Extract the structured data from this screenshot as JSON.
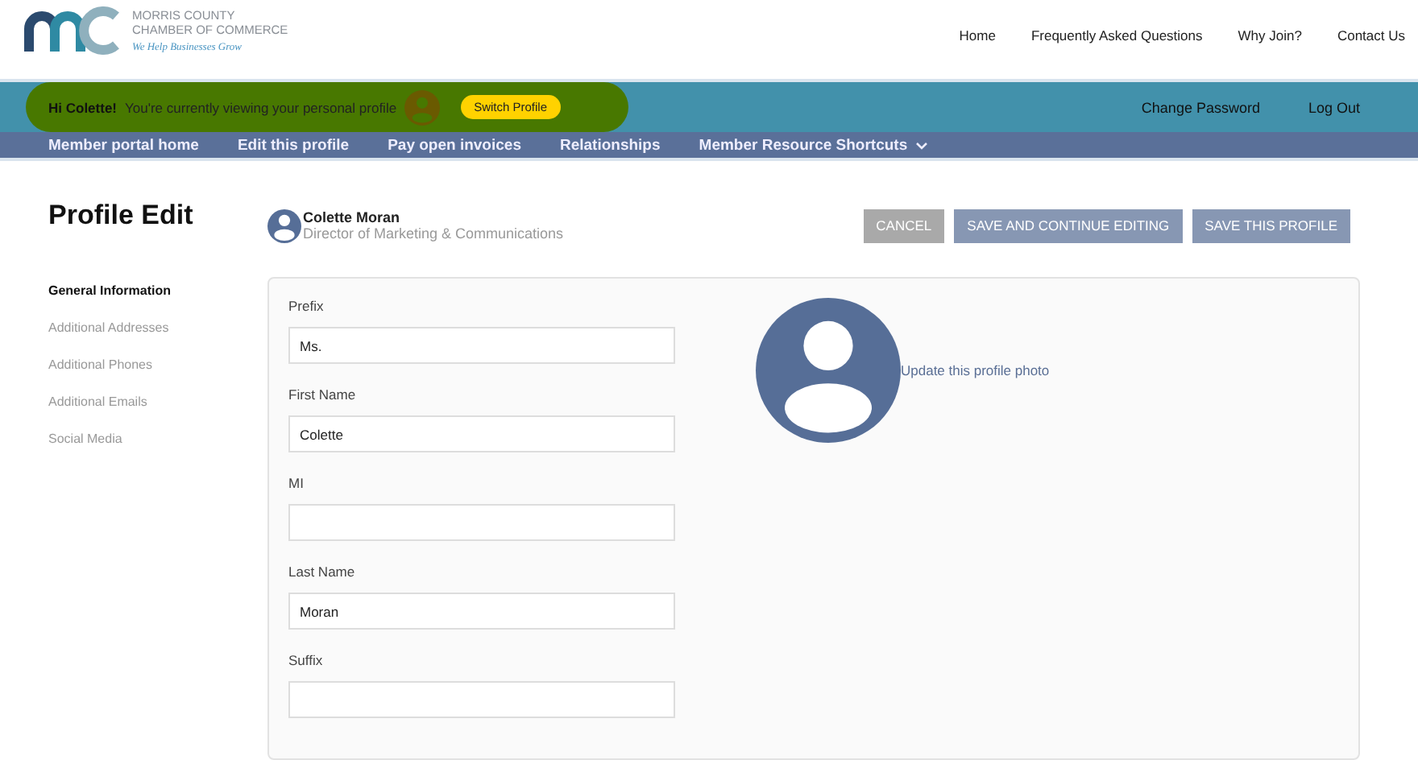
{
  "logo": {
    "line_1": "MORRIS COUNTY",
    "line_2": "CHAMBER OF COMMERCE",
    "tagline": "We Help Businesses Grow"
  },
  "top_nav": [
    "Home",
    "Frequently Asked Questions",
    "Why Join?",
    "Contact Us"
  ],
  "greeting": {
    "name": "Hi Colette!",
    "message": "You're currently viewing your personal profile",
    "button": "Switch Profile"
  },
  "account_links": [
    "Change Password",
    "Log Out"
  ],
  "main_nav": [
    {
      "label": "Member portal home",
      "dropdown": false
    },
    {
      "label": "Edit this profile",
      "dropdown": false
    },
    {
      "label": "Pay open invoices",
      "dropdown": false
    },
    {
      "label": "Relationships",
      "dropdown": false
    },
    {
      "label": "Member Resource Shortcuts",
      "dropdown": true
    }
  ],
  "page_title": "Profile Edit",
  "profile": {
    "name": "Colette Moran",
    "title": "Director of Marketing & Communications"
  },
  "actions": [
    {
      "label": "CANCEL",
      "kind": "secondary"
    },
    {
      "label": "SAVE AND CONTINUE EDITING",
      "kind": "primary"
    },
    {
      "label": "SAVE THIS PROFILE",
      "kind": "primary"
    }
  ],
  "side_nav": [
    {
      "label": "General Information",
      "selected": true
    },
    {
      "label": "Additional Addresses",
      "selected": false
    },
    {
      "label": "Additional Phones",
      "selected": false
    },
    {
      "label": "Additional Emails",
      "selected": false
    },
    {
      "label": "Social Media",
      "selected": false
    }
  ],
  "fields": [
    {
      "label": "Prefix",
      "value": "Ms."
    },
    {
      "label": "First Name",
      "value": "Colette"
    },
    {
      "label": "MI"
    },
    {
      "label": "Last Name",
      "value": "Moran"
    },
    {
      "label": "Suffix"
    }
  ],
  "photo_link": "Update this profile photo"
}
